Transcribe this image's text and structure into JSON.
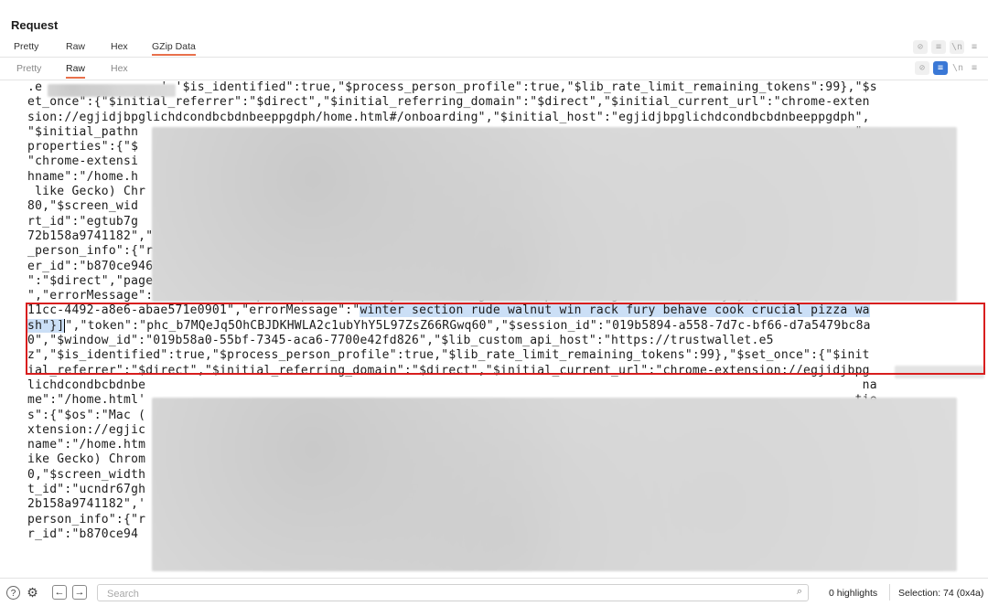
{
  "panel": {
    "title": "Request"
  },
  "tabs_top": [
    {
      "label": "Pretty"
    },
    {
      "label": "Raw"
    },
    {
      "label": "Hex"
    },
    {
      "label": "GZip Data"
    }
  ],
  "tabs_sub": [
    {
      "label": "Pretty"
    },
    {
      "label": "Raw"
    },
    {
      "label": "Hex"
    }
  ],
  "toolbar": {
    "newline_label": "\\n",
    "menu_label": "≡"
  },
  "code": {
    "lines": [
      ".e                ','$is_identified\":true,\"$process_person_profile\":true,\"$lib_rate_limit_remaining_tokens\":99},\"$s",
      "et_once\":{\"$initial_referrer\":\"$direct\",\"$initial_referring_domain\":\"$direct\",\"$initial_current_url\":\"chrome-exten",
      "sion://egjidjbpglichdcondbcbdnbeeppgdph/home.html#/onboarding\",\"$initial_host\":\"egjidjbpglichdcondbcbdnbeeppgdph\",",
      "\"$initial_pathn                                                                                                 \":",
      "properties\":{\"$                                                                                                 rl\":",
      "\"chrome-extensi                                                                                                 pat",
      "hname\":\"/home.h                                                                                                 IL,",
      " like Gecko) Chr                                                                                                 :10",
      "80,\"$screen_wid                                                                                                 nse",
      "rt_id\":\"egtub7g                                                                                                 20e",
      "72b158a9741182\",\"$device_id\":\"019b5894-a559-76fe-bd45-c97cce71d1ba\",\"version\":\"2.68.0\",\"distribution\":\"\",\"$initial",
      "_person_info\":{\"r\":\"$direct\",\"u\":\"chrome-extension://egjidjbpglichdcondbcbdnbeeppgdph/home.html#/onboarding\"},\"$us",
      "er_id\":\"b870ce946a442f4462de1e6af731b0745328b5245f9a62b20e72b158a9741182\",\"$referrer\":\"$direct\",\"$referring_domain",
      "\":\"$direct\",\"pageViewSource\":\"Unlock View\",\"status\":\"success\",\"error\":[{\"id\":\"dc7beb3e-a7b1-4f69-8c94-b4d2bcb06860",
      "\",\"errorMessage\":\"hotel vault option pool industry famous clog usual special neglect wild rally\"},{\"id\":\"834b26f1-",
      "11cc-4492-a8e6-abae571e0901\",\"errorMessage\":\"",
      "",
      "\",\"token\":\"phc_b7MQeJq5OhCBJDKHWLA2c1ubYhY5L97ZsZ66RGwq60\",\"$session_id\":\"019b5894-a558-7d7c-bf66-d7a5479bc8a",
      "0\",\"$window_id\":\"019b58a0-55bf-7345-aca6-7700e42fd826\",\"$lib_custom_api_host\":\"https://trustwallet.e5",
      "z\",\"$is_identified\":true,\"$process_person_profile\":true,\"$lib_rate_limit_remaining_tokens\":99},\"$set_once\":{\"$init",
      "ial_referrer\":\"$direct\",\"$initial_referring_domain\":\"$direct\",\"$initial_current_url\":\"chrome-extension://egjidjbpg",
      "lichdcondbcbdnbe                                                                                                 na",
      "me\":\"/home.html'                                                                                                tie",
      "s\":{\"$os\":\"Mac (                                                                                               e-e",
      "xtension://egjic                                                                                                 ith",
      "name\":\"/home.htm                                                                                                 l",
      "ike Gecko) Chrom                                                                                                .08",
      "0,\"$screen_width                                                                                                ser",
      "t_id\":\"ucndr67gh                                                                                               e7",
      "2b158a9741182\",'                                                                                                l_",
      "person_info\":{\"r                                                                                               use",
      "r_id\":\"b870ce94                                                                                                .n\""
    ],
    "highlight_part1": "winter section rude walnut win rack fury behave cook crucial pizza wa",
    "highlight_part2": "sh\"}]"
  },
  "search": {
    "placeholder": "Search"
  },
  "status": {
    "highlights": "0 highlights",
    "selection": "Selection: 74 (0x4a)"
  },
  "colors": {
    "accent": "#e8704b",
    "selection_box": "#d81e1e",
    "highlight": "#cbdff6",
    "toggle_on": "#3a78d6"
  }
}
